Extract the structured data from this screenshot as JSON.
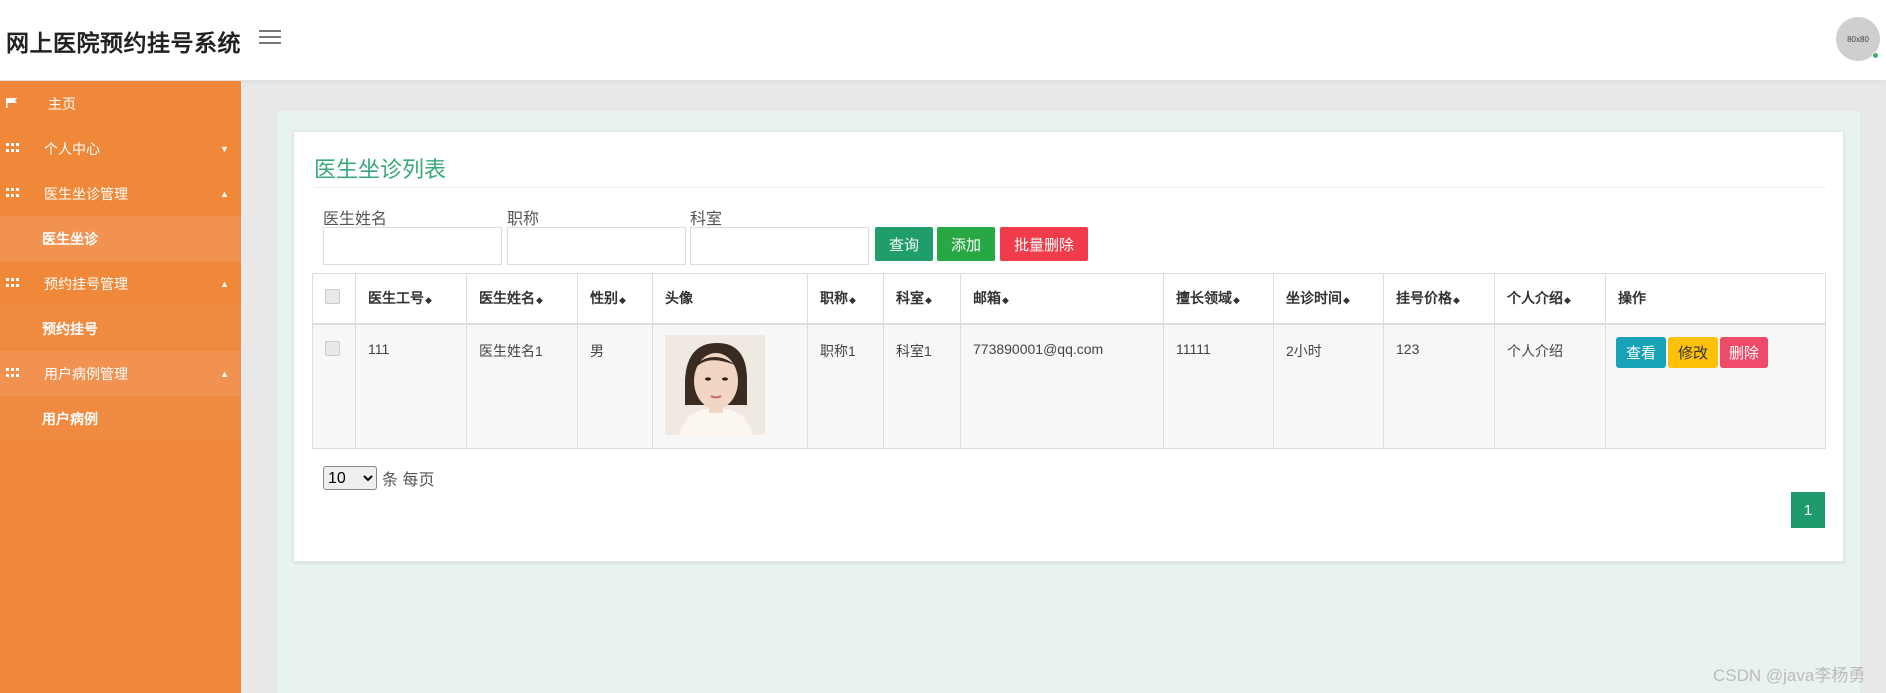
{
  "header": {
    "app_title": "网上医院预约挂号系统",
    "avatar_text": "80x80"
  },
  "sidebar": {
    "home": "主页",
    "personal_center": "个人中心",
    "groups": [
      {
        "label": "医生坐诊管理",
        "sub": "医生坐诊"
      },
      {
        "label": "预约挂号管理",
        "sub": "预约挂号"
      },
      {
        "label": "用户病例管理",
        "sub": "用户病例"
      }
    ]
  },
  "panel": {
    "title": "医生坐诊列表",
    "search": {
      "doctor_name_label": "医生姓名",
      "title_label": "职称",
      "department_label": "科室",
      "query_btn": "查询",
      "add_btn": "添加",
      "batch_delete_btn": "批量删除"
    },
    "table": {
      "columns": [
        "医生工号",
        "医生姓名",
        "性别",
        "头像",
        "职称",
        "科室",
        "邮箱",
        "擅长领域",
        "坐诊时间",
        "挂号价格",
        "个人介绍",
        "操作"
      ],
      "rows": [
        {
          "id": "111",
          "name": "医生姓名1",
          "gender": "男",
          "title": "职称1",
          "department": "科室1",
          "email": "773890001@qq.com",
          "specialty": "11111",
          "time": "2小时",
          "price": "123",
          "intro": "个人介绍"
        }
      ],
      "actions": {
        "view": "查看",
        "edit": "修改",
        "delete": "删除"
      }
    },
    "pagination": {
      "page_size": "10",
      "per_page_text": "条 每页",
      "current_page": "1"
    }
  },
  "watermark": "CSDN @java李杨勇",
  "colors": {
    "sidebar": "#f0883a",
    "accent": "#3aa87a",
    "page_active": "#1e9a6d"
  }
}
